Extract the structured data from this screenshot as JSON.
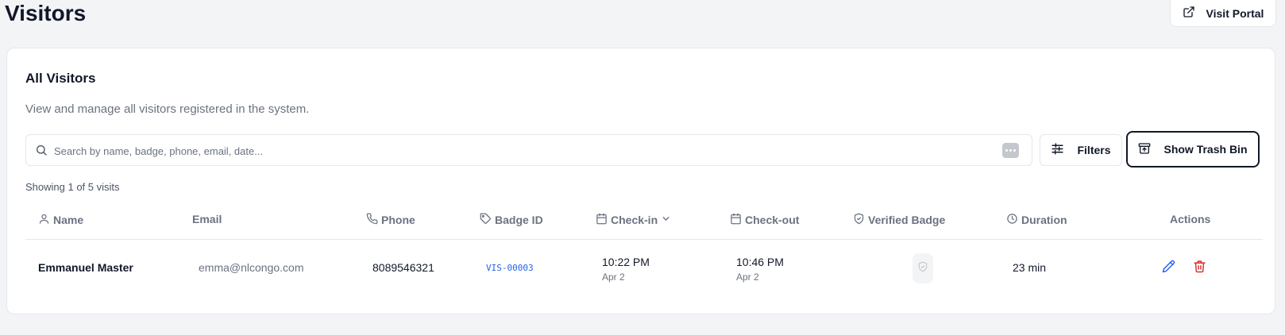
{
  "header": {
    "title": "Visitors",
    "visit_portal_label": "Visit Portal"
  },
  "card": {
    "title": "All Visitors",
    "description": "View and manage all visitors registered in the system."
  },
  "search": {
    "placeholder": "Search by name, badge, phone, email, date...",
    "value": ""
  },
  "toolbar": {
    "filters_label": "Filters",
    "trash_label": "Show Trash Bin"
  },
  "summary": {
    "showing_text": "Showing 1 of 5 visits"
  },
  "table": {
    "columns": {
      "name": "Name",
      "email": "Email",
      "phone": "Phone",
      "badge_id": "Badge ID",
      "check_in": "Check-in",
      "check_out": "Check-out",
      "verified_badge": "Verified Badge",
      "duration": "Duration",
      "actions": "Actions"
    },
    "rows": [
      {
        "name": "Emmanuel Master",
        "email": "emma@nlcongo.com",
        "phone": "8089546321",
        "badge_id": "VIS-00003",
        "check_in_time": "10:22 PM",
        "check_in_date": "Apr 2",
        "check_out_time": "10:46 PM",
        "check_out_date": "Apr 2",
        "duration": "23 min"
      }
    ]
  },
  "colors": {
    "accent_blue": "#2563eb",
    "danger_red": "#dc2626",
    "muted_text": "#6b7280",
    "page_bg": "#f3f4f6"
  },
  "icons": {
    "visit_portal": "external-link-icon",
    "search": "search-icon",
    "more": "more-icon",
    "filters": "sliders-icon",
    "trash": "archive-icon",
    "name": "user-icon",
    "phone": "phone-icon",
    "badge": "tag-icon",
    "check_in": "calendar-icon",
    "sort": "chevron-down-icon",
    "check_out": "calendar-icon",
    "verified": "shield-check-icon",
    "duration": "clock-icon",
    "edit": "pencil-icon",
    "delete": "trash-icon"
  }
}
